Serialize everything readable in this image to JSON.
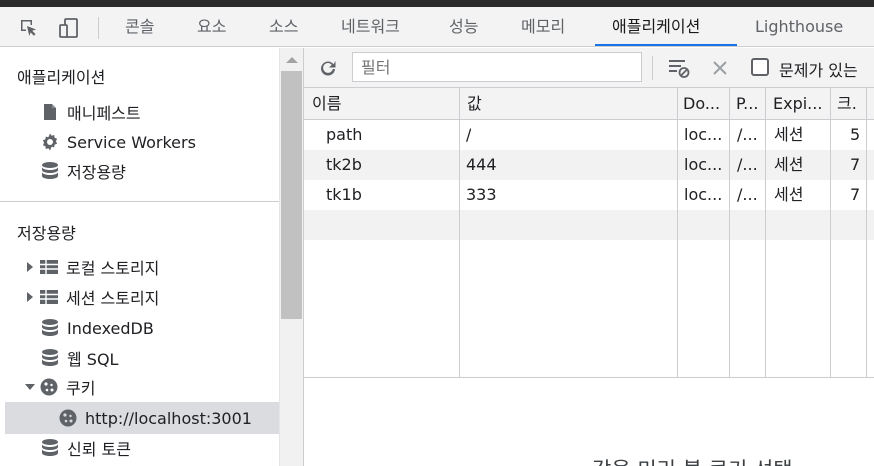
{
  "tabs": [
    "콘솔",
    "요소",
    "소스",
    "네트워크",
    "성능",
    "메모리",
    "애플리케이션",
    "Lighthouse"
  ],
  "active_tab": "애플리케이션",
  "sidebar": {
    "app_heading": "애플리케이션",
    "app_items": [
      {
        "label": "매니페스트",
        "icon": "file-icon"
      },
      {
        "label": "Service Workers",
        "icon": "gear-icon"
      },
      {
        "label": "저장용량",
        "icon": "database-icon"
      }
    ],
    "storage_heading": "저장용량",
    "storage_items": [
      {
        "label": "로컬 스토리지",
        "icon": "table-icon",
        "expandable": true
      },
      {
        "label": "세션 스토리지",
        "icon": "table-icon",
        "expandable": true
      },
      {
        "label": "IndexedDB",
        "icon": "database-icon"
      },
      {
        "label": "웹 SQL",
        "icon": "database-icon"
      },
      {
        "label": "쿠키",
        "icon": "cookie-icon",
        "expanded": true
      },
      {
        "label": "http://localhost:3001",
        "icon": "cookie-icon",
        "selected": true
      },
      {
        "label": "신뢰 토큰",
        "icon": "database-icon"
      }
    ]
  },
  "toolbar": {
    "filter_placeholder": "필터",
    "issues_label": "문제가 있는"
  },
  "table": {
    "columns": [
      "이름",
      "값",
      "Do...",
      "P...",
      "Expi...",
      "크.",
      ""
    ],
    "rows": [
      [
        "path",
        "/",
        "loc...",
        "/...",
        "세션",
        "5"
      ],
      [
        "tk2b",
        "444",
        "loc...",
        "/...",
        "세션",
        "7"
      ],
      [
        "tk1b",
        "333",
        "loc...",
        "/...",
        "세션",
        "7"
      ]
    ]
  },
  "preview_text": "값을 미리 볼 쿠키 선택"
}
